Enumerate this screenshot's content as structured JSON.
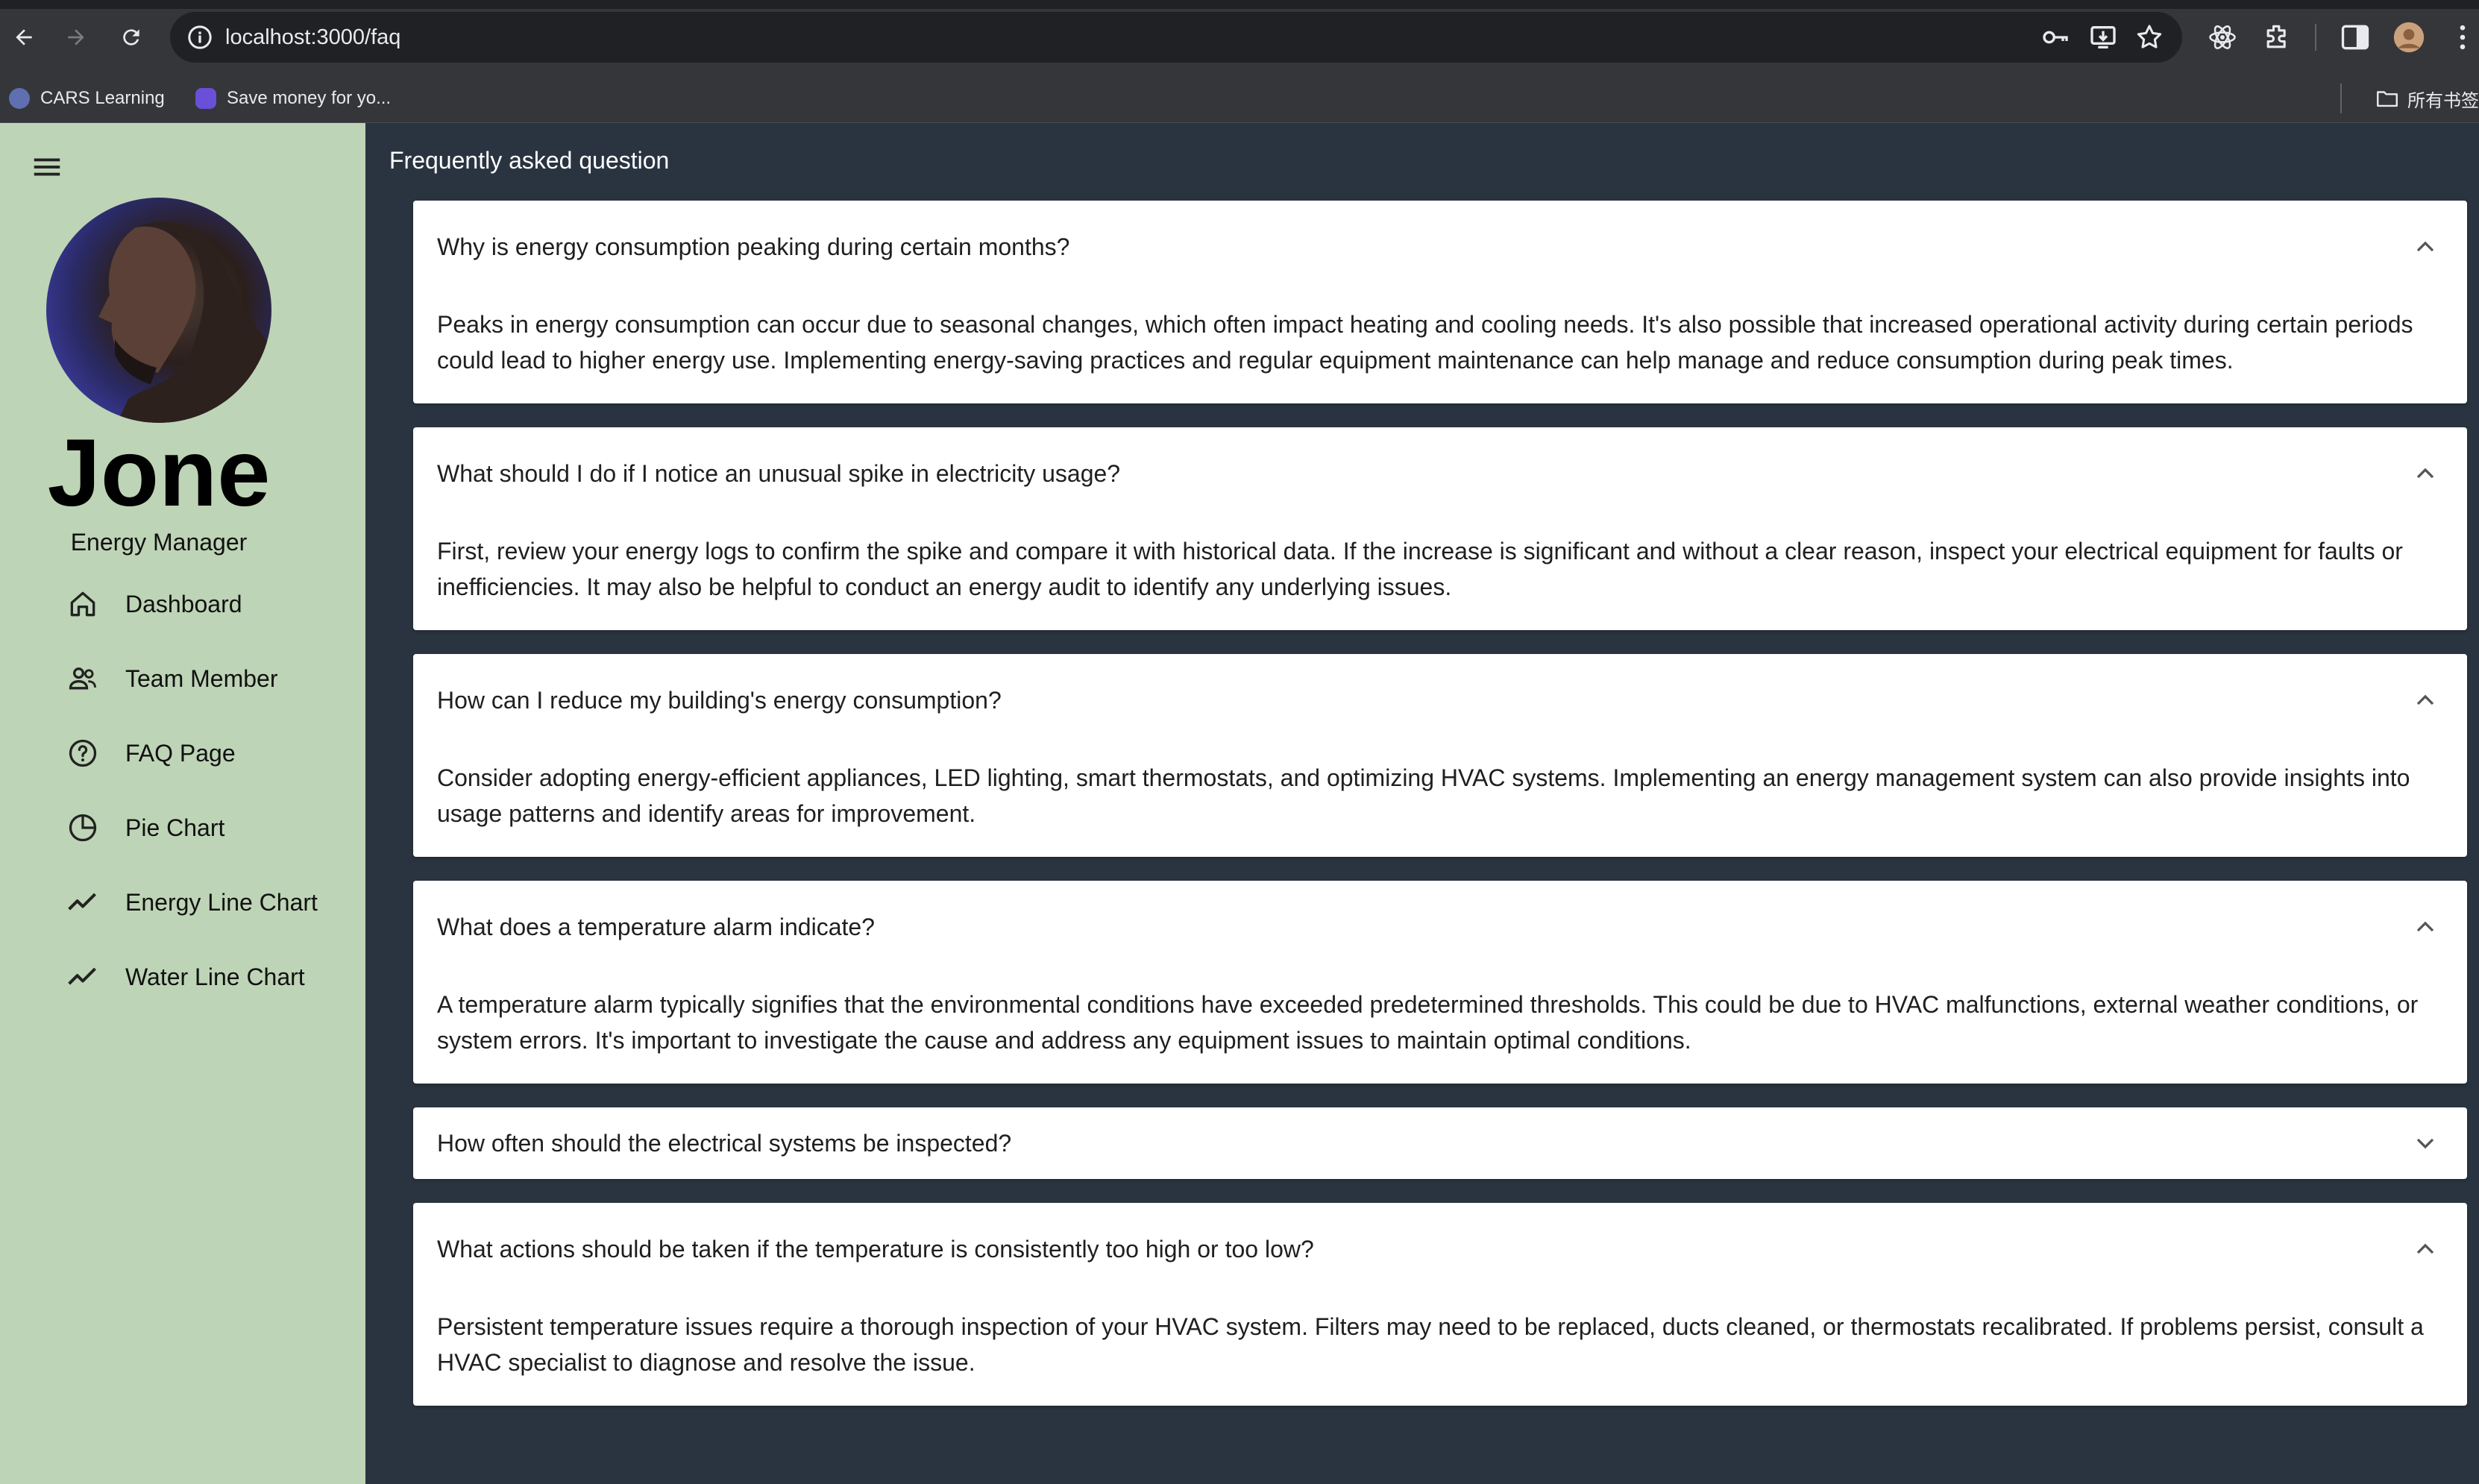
{
  "browser": {
    "url": "localhost:3000/faq",
    "bookmarks": [
      {
        "label": "CARS Learning"
      },
      {
        "label": "Save money for yo..."
      }
    ],
    "bookmarks_folder": "所有书签"
  },
  "sidebar": {
    "user": {
      "name": "Jone",
      "role": "Energy Manager"
    },
    "items": [
      {
        "label": "Dashboard",
        "icon": "home-icon"
      },
      {
        "label": "Team Member",
        "icon": "people-icon"
      },
      {
        "label": "FAQ Page",
        "icon": "help-circle-icon"
      },
      {
        "label": "Pie Chart",
        "icon": "pie-chart-icon"
      },
      {
        "label": "Energy Line Chart",
        "icon": "trend-line-icon"
      },
      {
        "label": "Water Line Chart",
        "icon": "trend-line-icon"
      }
    ]
  },
  "main": {
    "title": "Frequently asked question",
    "faqs": [
      {
        "question": "Why is energy consumption peaking during certain months?",
        "answer": "Peaks in energy consumption can occur due to seasonal changes, which often impact heating and cooling needs. It's also possible that increased operational activity during certain periods could lead to higher energy use. Implementing energy-saving practices and regular equipment maintenance can help manage and reduce consumption during peak times.",
        "expanded": true
      },
      {
        "question": "What should I do if I notice an unusual spike in electricity usage?",
        "answer": "First, review your energy logs to confirm the spike and compare it with historical data. If the increase is significant and without a clear reason, inspect your electrical equipment for faults or inefficiencies. It may also be helpful to conduct an energy audit to identify any underlying issues.",
        "expanded": true
      },
      {
        "question": "How can I reduce my building's energy consumption?",
        "answer": "Consider adopting energy-efficient appliances, LED lighting, smart thermostats, and optimizing HVAC systems. Implementing an energy management system can also provide insights into usage patterns and identify areas for improvement.",
        "expanded": true
      },
      {
        "question": "What does a temperature alarm indicate?",
        "answer": "A temperature alarm typically signifies that the environmental conditions have exceeded predetermined thresholds. This could be due to HVAC malfunctions, external weather conditions, or system errors. It's important to investigate the cause and address any equipment issues to maintain optimal conditions.",
        "expanded": true
      },
      {
        "question": "How often should the electrical systems be inspected?",
        "answer": "",
        "expanded": false
      },
      {
        "question": "What actions should be taken if the temperature is consistently too high or too low?",
        "answer": "Persistent temperature issues require a thorough inspection of your HVAC system. Filters may need to be replaced, ducts cleaned, or thermostats recalibrated. If problems persist, consult a HVAC specialist to diagnose and resolve the issue.",
        "expanded": true
      }
    ]
  }
}
